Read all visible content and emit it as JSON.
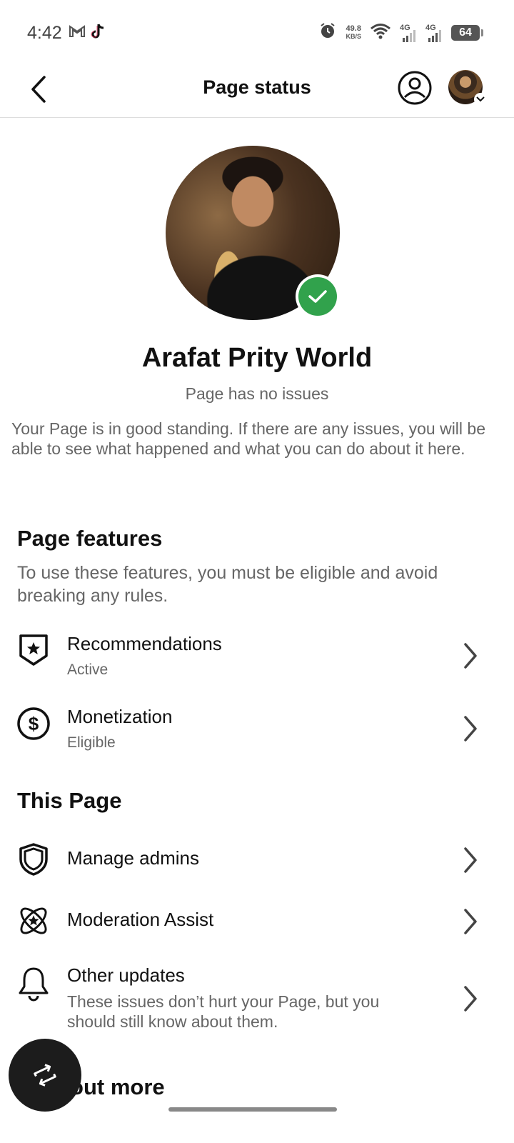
{
  "status_bar": {
    "time": "4:42",
    "speed_value": "49.8",
    "speed_unit": "KB/S",
    "network_1": "4G",
    "network_2": "4G",
    "battery": "64"
  },
  "header": {
    "title": "Page status"
  },
  "profile": {
    "name": "Arafat Prity World",
    "status": "Page has no issues",
    "description": "Your Page is in good standing. If there are any issues, you will be able to see what happened and what you can do about it here."
  },
  "page_features": {
    "title": "Page features",
    "description": "To use these features, you must be eligible and avoid breaking any rules.",
    "items": [
      {
        "label": "Recommendations",
        "status": "Active",
        "icon": "shield-star-icon"
      },
      {
        "label": "Monetization",
        "status": "Eligible",
        "icon": "dollar-circle-icon"
      }
    ]
  },
  "this_page": {
    "title": "This Page",
    "items": [
      {
        "label": "Manage admins",
        "icon": "shield-icon"
      },
      {
        "label": "Moderation Assist",
        "icon": "atom-star-icon"
      },
      {
        "label": "Other updates",
        "sub": "These issues don’t hurt your Page, but you should still know about them.",
        "icon": "bell-icon"
      }
    ]
  },
  "find_out_more": {
    "title": "Find out more"
  },
  "colors": {
    "verified_green": "#31a24c",
    "text_secondary": "#666666"
  }
}
